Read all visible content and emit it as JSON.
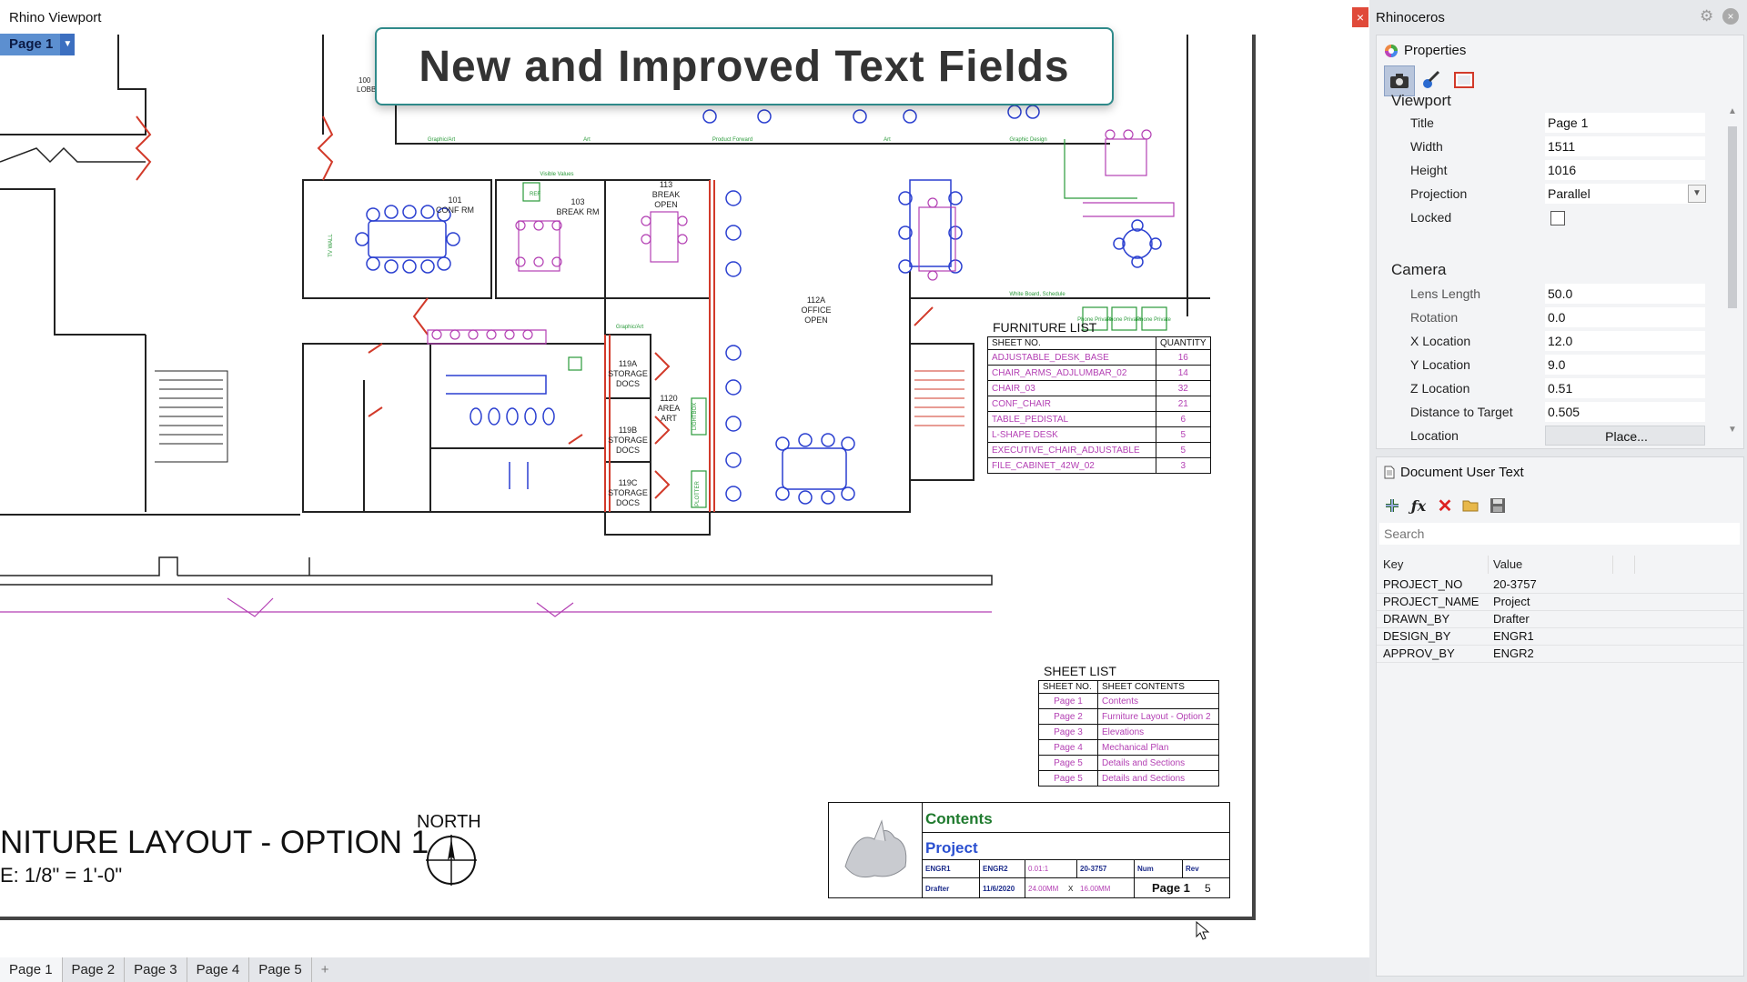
{
  "viewport": {
    "window_title": "Rhino Viewport",
    "close_glyph": "×",
    "page_button": "Page 1",
    "banner": "New and Improved Text Fields",
    "layout_title": "NITURE LAYOUT - OPTION 1",
    "scale_text": "E: 1/8\" = 1'-0\"",
    "north_label": "NORTH",
    "room_labels": [
      "101",
      "CONF RM",
      "103",
      "BREAK RM",
      "113",
      "BREAK",
      "OPEN",
      "112A",
      "OFFICE",
      "OPEN",
      "119A",
      "STORAGE",
      "DOCS",
      "1120",
      "AREA",
      "ART",
      "119B",
      "STORAGE",
      "DOCS",
      "119C",
      "STORAGE",
      "DOCS",
      "LIGHTBOX",
      "PLOTTER",
      "Visible Values",
      "Graphic/Art",
      "Art",
      "Product Forward",
      "Art",
      "Graphic Design",
      "White Board, Schedule",
      "Phone Private",
      "Phone Private",
      "Phone Private",
      "Graphic/Art",
      "TV WALL",
      "REF",
      "100",
      "LOBB"
    ],
    "furniture_list": {
      "caption": "FURNITURE LIST",
      "headers": [
        "SHEET NO.",
        "QUANTITY"
      ],
      "rows": [
        {
          "name": "ADJUSTABLE_DESK_BASE",
          "qty": "16"
        },
        {
          "name": "CHAIR_ARMS_ADJLUMBAR_02",
          "qty": "14"
        },
        {
          "name": "CHAIR_03",
          "qty": "32"
        },
        {
          "name": "CONF_CHAIR",
          "qty": "21"
        },
        {
          "name": "TABLE_PEDISTAL",
          "qty": "6"
        },
        {
          "name": "L-SHAPE DESK",
          "qty": "5"
        },
        {
          "name": "EXECUTIVE_CHAIR_ADJUSTABLE",
          "qty": "5"
        },
        {
          "name": "FILE_CABINET_42W_02",
          "qty": "3"
        }
      ]
    },
    "sheet_list": {
      "caption": "SHEET LIST",
      "headers": [
        "SHEET NO.",
        "SHEET CONTENTS"
      ],
      "rows": [
        {
          "no": "Page 1",
          "contents": "Contents"
        },
        {
          "no": "Page 2",
          "contents": "Furniture Layout - Option 2"
        },
        {
          "no": "Page 3",
          "contents": "Elevations"
        },
        {
          "no": "Page 4",
          "contents": "Mechanical Plan"
        },
        {
          "no": "Page 5",
          "contents": "Details and Sections"
        },
        {
          "no": "Page 5",
          "contents": "Details and Sections"
        }
      ]
    },
    "title_block": {
      "contents": "Contents",
      "project": "Project",
      "engr1": "ENGR1",
      "engr2": "ENGR2",
      "ratio": "0.01:1",
      "project_no": "20-3757",
      "num": "Num",
      "rev": "Rev",
      "drafter": "Drafter",
      "date": "11/6/2020",
      "width": "24.00MM",
      "x_sep": "X",
      "height": "16.00MM",
      "page": "Page 1",
      "page_count": "5"
    },
    "tabs": [
      "Page 1",
      "Page 2",
      "Page 3",
      "Page 4",
      "Page 5"
    ],
    "add_tab": "+"
  },
  "panel": {
    "title": "Rhinoceros",
    "close_glyph": "×",
    "gear_glyph": "⚙",
    "properties": {
      "header": "Properties",
      "section_viewport": "Viewport",
      "title_label": "Title",
      "title_value": "Page 1",
      "width_label": "Width",
      "width_value": "1511",
      "height_label": "Height",
      "height_value": "1016",
      "projection_label": "Projection",
      "projection_value": "Parallel",
      "locked_label": "Locked",
      "section_camera": "Camera",
      "lens_label": "Lens Length",
      "lens_value": "50.0",
      "rotation_label": "Rotation",
      "rotation_value": "0.0",
      "xloc_label": "X Location",
      "xloc_value": "12.0",
      "yloc_label": "Y Location",
      "yloc_value": "9.0",
      "zloc_label": "Z Location",
      "zloc_value": "0.51",
      "dist_label": "Distance to Target",
      "dist_value": "0.505",
      "location_label": "Location",
      "location_button": "Place..."
    },
    "user_text": {
      "header": "Document User Text",
      "search_placeholder": "Search",
      "col_key": "Key",
      "col_value": "Value",
      "rows": [
        {
          "key": "PROJECT_NO",
          "value": "20-3757"
        },
        {
          "key": "PROJECT_NAME",
          "value": "Project"
        },
        {
          "key": "DRAWN_BY",
          "value": "Drafter"
        },
        {
          "key": "DESIGN_BY",
          "value": "ENGR1"
        },
        {
          "key": "APPROV_BY",
          "value": "ENGR2"
        }
      ]
    }
  },
  "colors": {
    "accent_blue": "#5c8fd0",
    "furniture_magenta": "#b33fb3",
    "furniture_blue": "#2a3fd0",
    "wall_red": "#d23a2a",
    "title_green": "#1f7a2e"
  }
}
